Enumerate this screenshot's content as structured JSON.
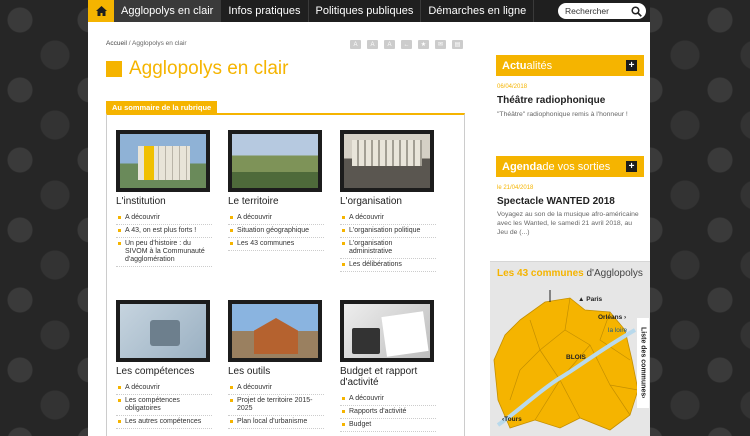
{
  "nav": {
    "items": [
      "Agglopolys en clair",
      "Infos pratiques",
      "Politiques publiques",
      "Démarches en ligne"
    ],
    "search_placeholder": "Rechercher"
  },
  "breadcrumb": {
    "home": "Accueil",
    "separator": " / ",
    "current": "Agglopolys en clair"
  },
  "page_title": "Agglopolys en clair",
  "summary_label": "Au sommaire de la rubrique",
  "cards": [
    {
      "title": "L'institution",
      "links": [
        "A découvrir",
        "A 43, on est plus forts !",
        "Un peu d'histoire : du SIVOM à la Communauté d'agglomération"
      ]
    },
    {
      "title": "Le territoire",
      "links": [
        "A découvrir",
        "Situation géographique",
        "Les 43 communes"
      ]
    },
    {
      "title": "L'organisation",
      "links": [
        "A découvrir",
        "L'organisation politique",
        "L'organisation administrative",
        "Les délibérations"
      ]
    },
    {
      "title": "Les compétences",
      "links": [
        "A découvrir",
        "Les compétences obligatoires",
        "Les autres compétences"
      ]
    },
    {
      "title": "Les outils",
      "links": [
        "A découvrir",
        "Projet de territoire 2015-2025",
        "Plan local d'urbanisme"
      ]
    },
    {
      "title": "Budget et rapport d'activité",
      "links": [
        "A découvrir",
        "Rapports d'activité",
        "Budget"
      ]
    }
  ],
  "news": {
    "head_bold": "Actu",
    "head_rest": "alités",
    "date": "06/04/2018",
    "title": "Théâtre radiophonique",
    "desc": "\"Théâtre\" radiophonique remis à l'honneur !"
  },
  "agenda": {
    "head_bold": "Agenda",
    "head_rest": " de vos sorties",
    "date": "le 21/04/2018",
    "title": "Spectacle WANTED 2018",
    "desc": "Voyagez au son de la musique afro-américaine avec les Wanted, le samedi 21 avril 2018, au Jeu de (...)"
  },
  "map": {
    "title_bold": "Les 43 communes",
    "title_rest": " d'Agglopolys",
    "labels": {
      "paris": "Paris",
      "orleans": "Orléans",
      "loire": "la loire",
      "blois": "BLOIS",
      "tours": "Tours"
    },
    "side_tab": "Liste des communes"
  },
  "colors": {
    "accent": "#f5b400",
    "nav_bg": "#1f1f1f"
  }
}
